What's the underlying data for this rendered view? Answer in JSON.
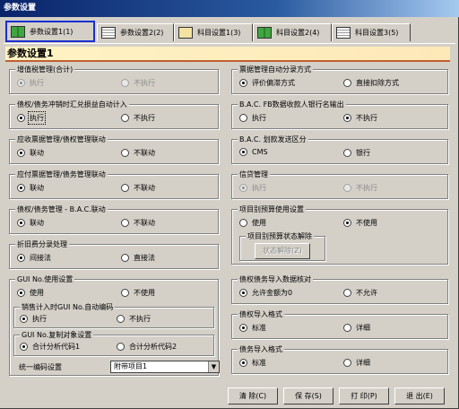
{
  "window": {
    "title": "参数设置"
  },
  "tabs": [
    {
      "label": "参数设置1(1)",
      "icon": "book-icon"
    },
    {
      "label": "参数设置2(2)",
      "icon": "document-icon"
    },
    {
      "label": "科目设置1(3)",
      "icon": "box-icon"
    },
    {
      "label": "科目设置2(4)",
      "icon": "book-icon"
    },
    {
      "label": "科目设置3(5)",
      "icon": "document-icon"
    }
  ],
  "page": {
    "header": "参数设置1"
  },
  "groups": {
    "vat": {
      "title": "增值税管理(合计)",
      "opt1": "执行",
      "opt2": "不执行"
    },
    "fx": {
      "title": "债权/债务冲销时汇兑损益自动计入",
      "opt1": "执行",
      "opt2": "不执行"
    },
    "recv": {
      "title": "应收票据管理/债权管理联动",
      "opt1": "联动",
      "opt2": "不联动"
    },
    "pay": {
      "title": "应付票据管理/债务管理联动",
      "opt1": "联动",
      "opt2": "不联动"
    },
    "bac": {
      "title": "债权/债务管理 - B.A.C.联动",
      "opt1": "联动",
      "opt2": "不联动"
    },
    "depr": {
      "title": "折旧费分录处理",
      "opt1": "间接法",
      "opt2": "直接法"
    },
    "gui": {
      "title": "GUI No.使用设置",
      "opt1": "使用",
      "opt2": "不使用",
      "sub1": {
        "title": "销售计入时GUI No.自动编码",
        "opt1": "执行",
        "opt2": "不执行"
      },
      "sub2": {
        "title": "GUI No.复制对象设置",
        "opt1": "合计分析代码1",
        "opt2": "合计分析代码2"
      },
      "unified_label": "统一编码设置",
      "unified_value": "附带项目1"
    },
    "bill": {
      "title": "票据管理自动分录方式",
      "opt1": "评价偏滞方式",
      "opt2": "直接扣除方式"
    },
    "fb": {
      "title": "B.A.C. FB数据收款人银行名输出",
      "opt1": "执行",
      "opt2": "不执行"
    },
    "bacsend": {
      "title": "B.A.C. 划款发送区分",
      "opt1": "CMS",
      "opt2": "银行"
    },
    "credit": {
      "title": "信贷管理",
      "opt1": "执行",
      "opt2": "不执行"
    },
    "budget": {
      "title": "项目别预算使用设置",
      "opt1": "使用",
      "opt2": "不使用",
      "sub": {
        "title": "项目别预算状态解除",
        "button": "状态解除(Z)"
      }
    },
    "dimport": {
      "title": "债权债务导入数据核对",
      "opt1": "允许金额为0",
      "opt2": "不允许"
    },
    "cimport": {
      "title": "债权导入格式",
      "opt1": "标准",
      "opt2": "详细"
    },
    "bimport": {
      "title": "债务导入格式",
      "opt1": "标准",
      "opt2": "详细"
    }
  },
  "footer": {
    "clear": "清 除(C)",
    "save": "保 存(S)",
    "print": "打 印(P)",
    "exit": "退 出(E)"
  }
}
